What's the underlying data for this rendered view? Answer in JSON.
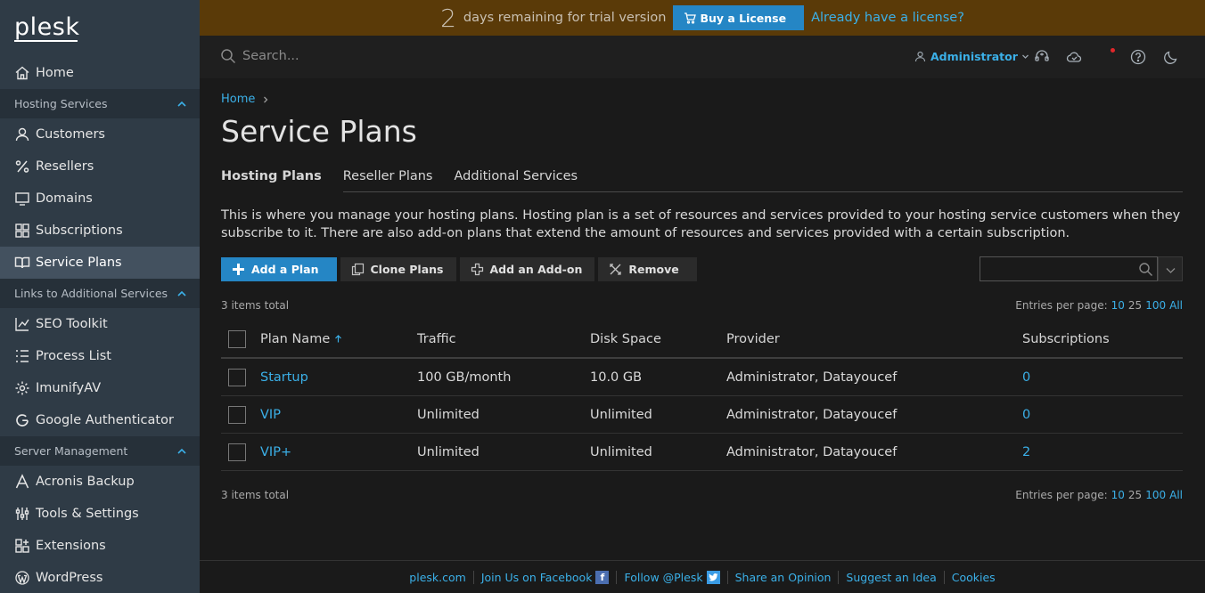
{
  "brand": {
    "logo_text": "plesk"
  },
  "sidebar": {
    "items": [
      {
        "label": "Home",
        "icon": "home-icon"
      },
      {
        "section": "Hosting Services"
      },
      {
        "label": "Customers",
        "icon": "user-icon"
      },
      {
        "label": "Resellers",
        "icon": "percent-icon"
      },
      {
        "label": "Domains",
        "icon": "monitor-icon"
      },
      {
        "label": "Subscriptions",
        "icon": "grid-icon"
      },
      {
        "label": "Service Plans",
        "icon": "book-icon",
        "active": true
      },
      {
        "section": "Links to Additional Services"
      },
      {
        "label": "SEO Toolkit",
        "icon": "chart-icon"
      },
      {
        "label": "Process List",
        "icon": "list-icon"
      },
      {
        "label": "ImunifyAV",
        "icon": "gear-icon"
      },
      {
        "label": "Google Authenticator",
        "icon": "google-icon"
      },
      {
        "section": "Server Management"
      },
      {
        "label": "Acronis Backup",
        "icon": "acronis-icon"
      },
      {
        "label": "Tools & Settings",
        "icon": "tools-icon"
      },
      {
        "label": "Extensions",
        "icon": "extensions-icon"
      },
      {
        "label": "WordPress",
        "icon": "wordpress-icon"
      }
    ]
  },
  "trial": {
    "days": "2",
    "text": "days remaining for trial version",
    "buy_label": "Buy a License",
    "already_label": "Already have a license?"
  },
  "topbar": {
    "search_placeholder": "Search...",
    "user": "Administrator"
  },
  "breadcrumb": {
    "home": "Home"
  },
  "page": {
    "title": "Service Plans",
    "tabs": [
      "Hosting Plans",
      "Reseller Plans",
      "Additional Services"
    ],
    "active_tab": "Hosting Plans",
    "description": "This is where you manage your hosting plans. Hosting plan is a set of resources and services provided to your hosting service customers when they subscribe to it. There are also add-on plans that extend the amount of resources and services provided with a certain subscription."
  },
  "toolbar": {
    "add_plan": "Add a Plan",
    "clone_plans": "Clone Plans",
    "add_addon": "Add an Add-on",
    "remove": "Remove"
  },
  "list": {
    "total_text": "3 items total",
    "entries_label": "Entries per page:",
    "page_sizes": [
      "10",
      "25",
      "100",
      "All"
    ],
    "current_page_size": "25",
    "columns": [
      "Plan Name",
      "Traffic",
      "Disk Space",
      "Provider",
      "Subscriptions"
    ],
    "rows": [
      {
        "name": "Startup",
        "traffic": "100 GB/month",
        "disk": "10.0 GB",
        "provider": "Administrator, Datayoucef",
        "subscriptions": "0"
      },
      {
        "name": "VIP",
        "traffic": "Unlimited",
        "disk": "Unlimited",
        "provider": "Administrator, Datayoucef",
        "subscriptions": "0"
      },
      {
        "name": "VIP+",
        "traffic": "Unlimited",
        "disk": "Unlimited",
        "provider": "Administrator, Datayoucef",
        "subscriptions": "2"
      }
    ]
  },
  "footer": {
    "links": [
      "plesk.com",
      "Join Us on Facebook",
      "Follow @Plesk",
      "Share an Opinion",
      "Suggest an Idea",
      "Cookies"
    ]
  },
  "colors": {
    "accent": "#3bb0e8",
    "primary_button": "#2586c5",
    "sidebar": "#2f3b46",
    "banner": "#5a3a08"
  }
}
